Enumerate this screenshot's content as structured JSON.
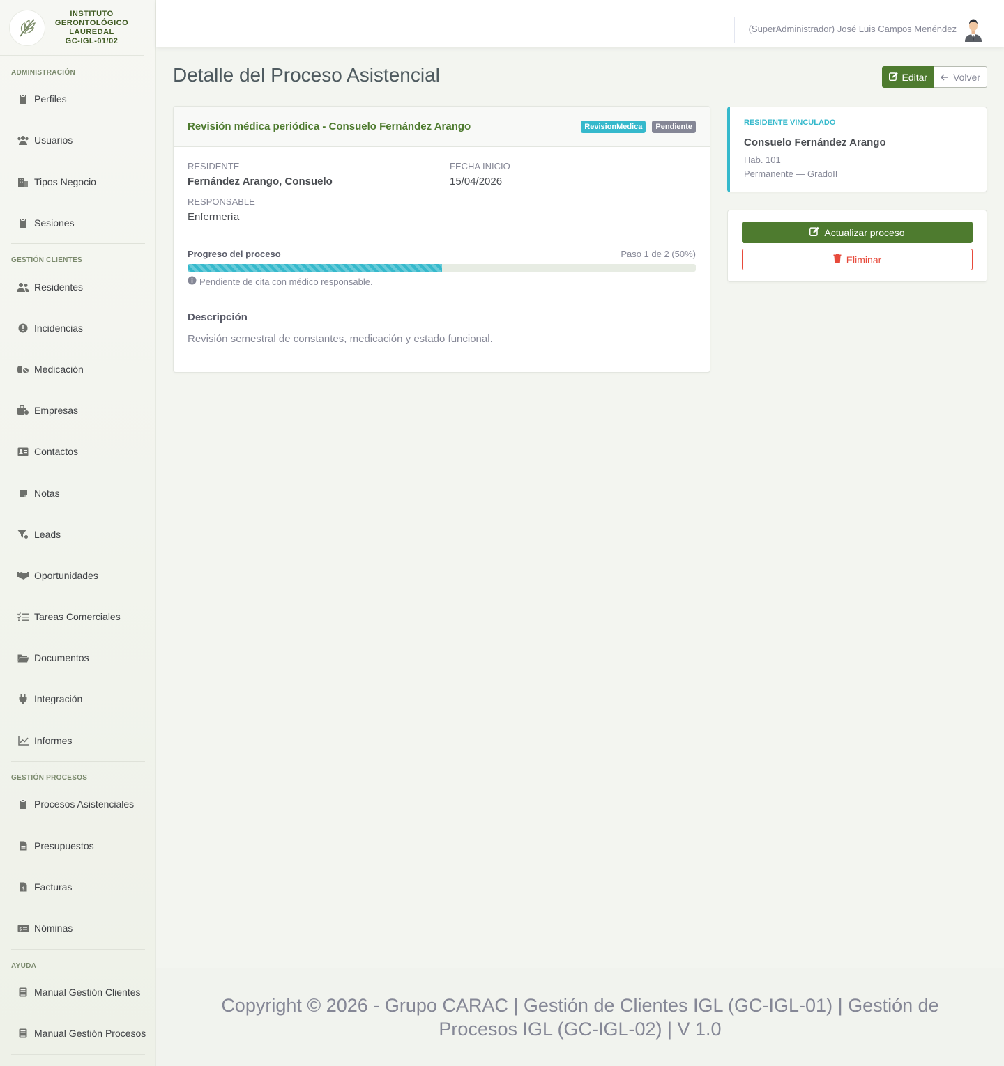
{
  "brand": {
    "line1": "INSTITUTO",
    "line2": "GERONTOLÓGICO",
    "line3": "LAUREDAL",
    "code": "GC-IGL-01/02"
  },
  "sidebar": {
    "sections": [
      {
        "title": "ADMINISTRACIÓN",
        "items": [
          {
            "label": "Perfiles",
            "icon": "clipboard-icon"
          },
          {
            "label": "Usuarios",
            "icon": "users-icon"
          },
          {
            "label": "Tipos Negocio",
            "icon": "building-icon"
          },
          {
            "label": "Sesiones",
            "icon": "clipboard-icon"
          }
        ]
      },
      {
        "title": "GESTIÓN CLIENTES",
        "items": [
          {
            "label": "Residentes",
            "icon": "user-group-icon"
          },
          {
            "label": "Incidencias",
            "icon": "alert-icon"
          },
          {
            "label": "Medicación",
            "icon": "pills-icon"
          },
          {
            "label": "Empresas",
            "icon": "briefcase-icon"
          },
          {
            "label": "Contactos",
            "icon": "id-card-icon"
          },
          {
            "label": "Notas",
            "icon": "note-icon"
          },
          {
            "label": "Leads",
            "icon": "funnel-icon"
          },
          {
            "label": "Oportunidades",
            "icon": "handshake-icon"
          },
          {
            "label": "Tareas Comerciales",
            "icon": "tasks-icon"
          },
          {
            "label": "Documentos",
            "icon": "folder-icon"
          },
          {
            "label": "Integración",
            "icon": "plug-icon"
          },
          {
            "label": "Informes",
            "icon": "chart-line-icon"
          }
        ]
      },
      {
        "title": "GESTIÓN PROCESOS",
        "items": [
          {
            "label": "Procesos Asistenciales",
            "icon": "clipboard-icon"
          },
          {
            "label": "Presupuestos",
            "icon": "file-icon"
          },
          {
            "label": "Facturas",
            "icon": "invoice-icon"
          },
          {
            "label": "Nóminas",
            "icon": "money-icon"
          }
        ]
      },
      {
        "title": "AYUDA",
        "items": [
          {
            "label": "Manual Gestión Clientes",
            "icon": "book-icon"
          },
          {
            "label": "Manual Gestión Procesos",
            "icon": "book-icon"
          }
        ]
      }
    ]
  },
  "topbar": {
    "user": "(SuperAdministrador) José Luis Campos Menéndez"
  },
  "page": {
    "title": "Detalle del Proceso Asistencial",
    "edit_label": "Editar",
    "back_label": "Volver"
  },
  "process": {
    "title": "Revisión médica periódica - Consuelo Fernández Arango",
    "type_badge": "RevisionMedica",
    "status_badge": "Pendiente",
    "resident_label": "RESIDENTE",
    "resident_value": "Fernández Arango, Consuelo",
    "start_label": "FECHA INICIO",
    "start_value": "15/04/2026",
    "responsible_label": "RESPONSABLE",
    "responsible_value": "Enfermería",
    "progress_label": "Progreso del proceso",
    "progress_step": "Paso 1 de 2 (50%)",
    "progress_fraction": 0.5,
    "progress_note": "Pendiente de cita con médico responsable.",
    "description_title": "Descripción",
    "description_text": "Revisión semestral de constantes, medicación y estado funcional."
  },
  "linked_resident": {
    "label": "RESIDENTE VINCULADO",
    "name": "Consuelo Fernández Arango",
    "room": "Hab. 101",
    "stay": "Permanente — GradoII"
  },
  "actions": {
    "update_label": "Actualizar proceso",
    "delete_label": "Eliminar"
  },
  "footer": {
    "text": "Copyright © 2026 - Grupo CARAC | Gestión de Clientes IGL (GC-IGL-01) | Gestión de Procesos IGL (GC-IGL-02) | V 1.0"
  },
  "colors": {
    "primary_green": "#4e7b2f",
    "info_cyan": "#36b9cc",
    "danger_red": "#e74a3b",
    "muted_gray": "#858796"
  }
}
